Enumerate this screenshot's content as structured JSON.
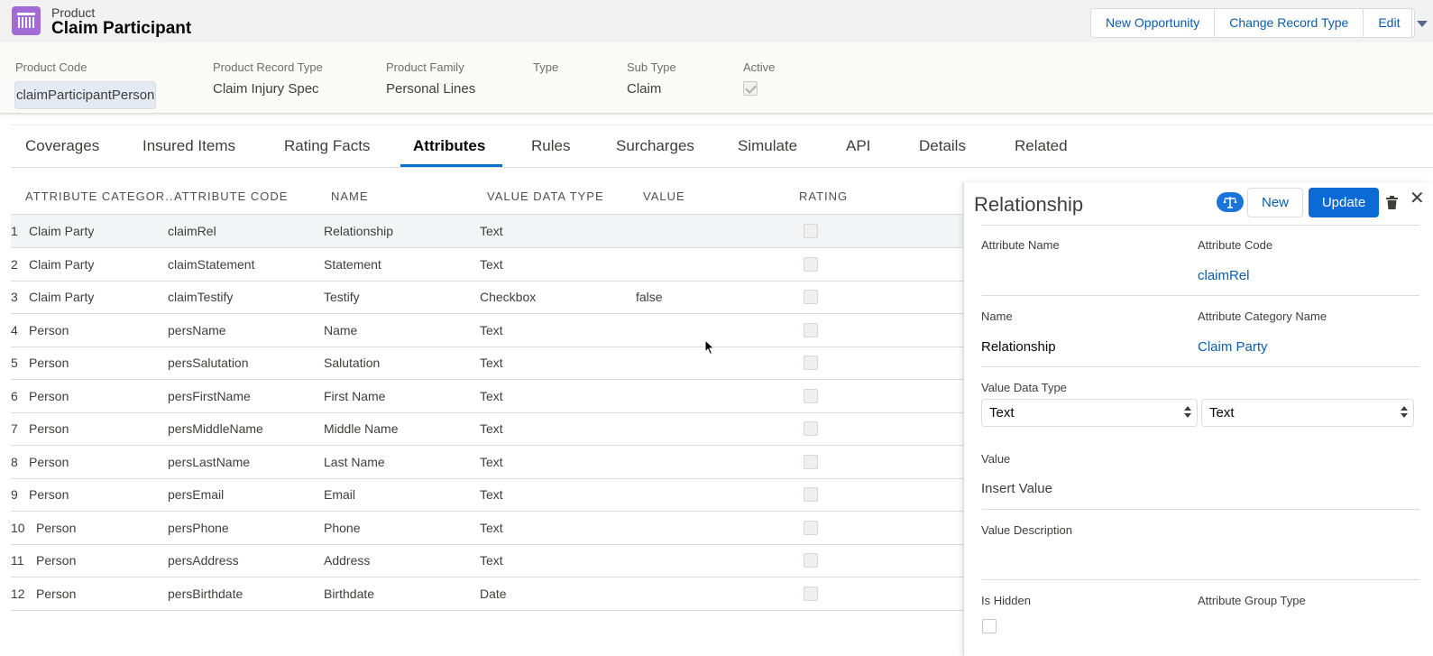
{
  "header": {
    "object_label": "Product",
    "record_title": "Claim Participant",
    "actions": [
      "New Opportunity",
      "Change Record Type",
      "Edit"
    ]
  },
  "highlights": [
    {
      "label": "Product Code",
      "value": "claimParticipantPerson"
    },
    {
      "label": "Product Record Type",
      "value": "Claim Injury Spec"
    },
    {
      "label": "Product Family",
      "value": "Personal Lines"
    },
    {
      "label": "Type",
      "value": ""
    },
    {
      "label": "Sub Type",
      "value": "Claim"
    },
    {
      "label": "Active",
      "value": ""
    }
  ],
  "active_checked": true,
  "tabs": [
    "Coverages",
    "Insured Items",
    "Rating Facts",
    "Attributes",
    "Rules",
    "Surcharges",
    "Simulate",
    "API",
    "Details",
    "Related"
  ],
  "active_tab": "Attributes",
  "table": {
    "headers": [
      "ATTRIBUTE CATEGOR...",
      "ATTRIBUTE CODE",
      "NAME",
      "VALUE DATA TYPE",
      "VALUE",
      "RATING"
    ],
    "rows": [
      {
        "num": "1",
        "category": "Claim Party",
        "code": "claimRel",
        "name": "Relationship",
        "type": "Text",
        "value": ""
      },
      {
        "num": "2",
        "category": "Claim Party",
        "code": "claimStatement",
        "name": "Statement",
        "type": "Text",
        "value": ""
      },
      {
        "num": "3",
        "category": "Claim Party",
        "code": "claimTestify",
        "name": "Testify",
        "type": "Checkbox",
        "value": "false"
      },
      {
        "num": "4",
        "category": "Person",
        "code": "persName",
        "name": "Name",
        "type": "Text",
        "value": ""
      },
      {
        "num": "5",
        "category": "Person",
        "code": "persSalutation",
        "name": "Salutation",
        "type": "Text",
        "value": ""
      },
      {
        "num": "6",
        "category": "Person",
        "code": "persFirstName",
        "name": "First Name",
        "type": "Text",
        "value": ""
      },
      {
        "num": "7",
        "category": "Person",
        "code": "persMiddleName",
        "name": "Middle Name",
        "type": "Text",
        "value": ""
      },
      {
        "num": "8",
        "category": "Person",
        "code": "persLastName",
        "name": "Last Name",
        "type": "Text",
        "value": ""
      },
      {
        "num": "9",
        "category": "Person",
        "code": "persEmail",
        "name": "Email",
        "type": "Text",
        "value": ""
      },
      {
        "num": "10",
        "category": "Person",
        "code": "persPhone",
        "name": "Phone",
        "type": "Text",
        "value": ""
      },
      {
        "num": "11",
        "category": "Person",
        "code": "persAddress",
        "name": "Address",
        "type": "Text",
        "value": ""
      },
      {
        "num": "12",
        "category": "Person",
        "code": "persBirthdate",
        "name": "Birthdate",
        "type": "Date",
        "value": ""
      }
    ]
  },
  "panel": {
    "title": "Relationship",
    "new_label": "New",
    "update_label": "Update",
    "attribute_name_label": "Attribute Name",
    "attribute_name_value": "",
    "attribute_code_label": "Attribute Code",
    "attribute_code_value": "claimRel",
    "name_label": "Name",
    "name_value": "Relationship",
    "category_label": "Attribute Category Name",
    "category_value": "Claim Party",
    "value_data_type_label": "Value Data Type",
    "value_data_type_1": "Text",
    "value_data_type_2": "Text",
    "value_label": "Value",
    "value_placeholder": "Insert Value",
    "value_description_label": "Value Description",
    "is_hidden_label": "Is Hidden",
    "group_type_label": "Attribute Group Type"
  },
  "icons": {
    "product": "product-icon",
    "scale": "scale-icon",
    "trash": "trash-icon",
    "close": "close-icon",
    "more": "chevron-down-icon"
  },
  "colors": {
    "brand": "#0b6ad4",
    "link": "#0b5cab",
    "product_icon": "#a26bd5"
  }
}
